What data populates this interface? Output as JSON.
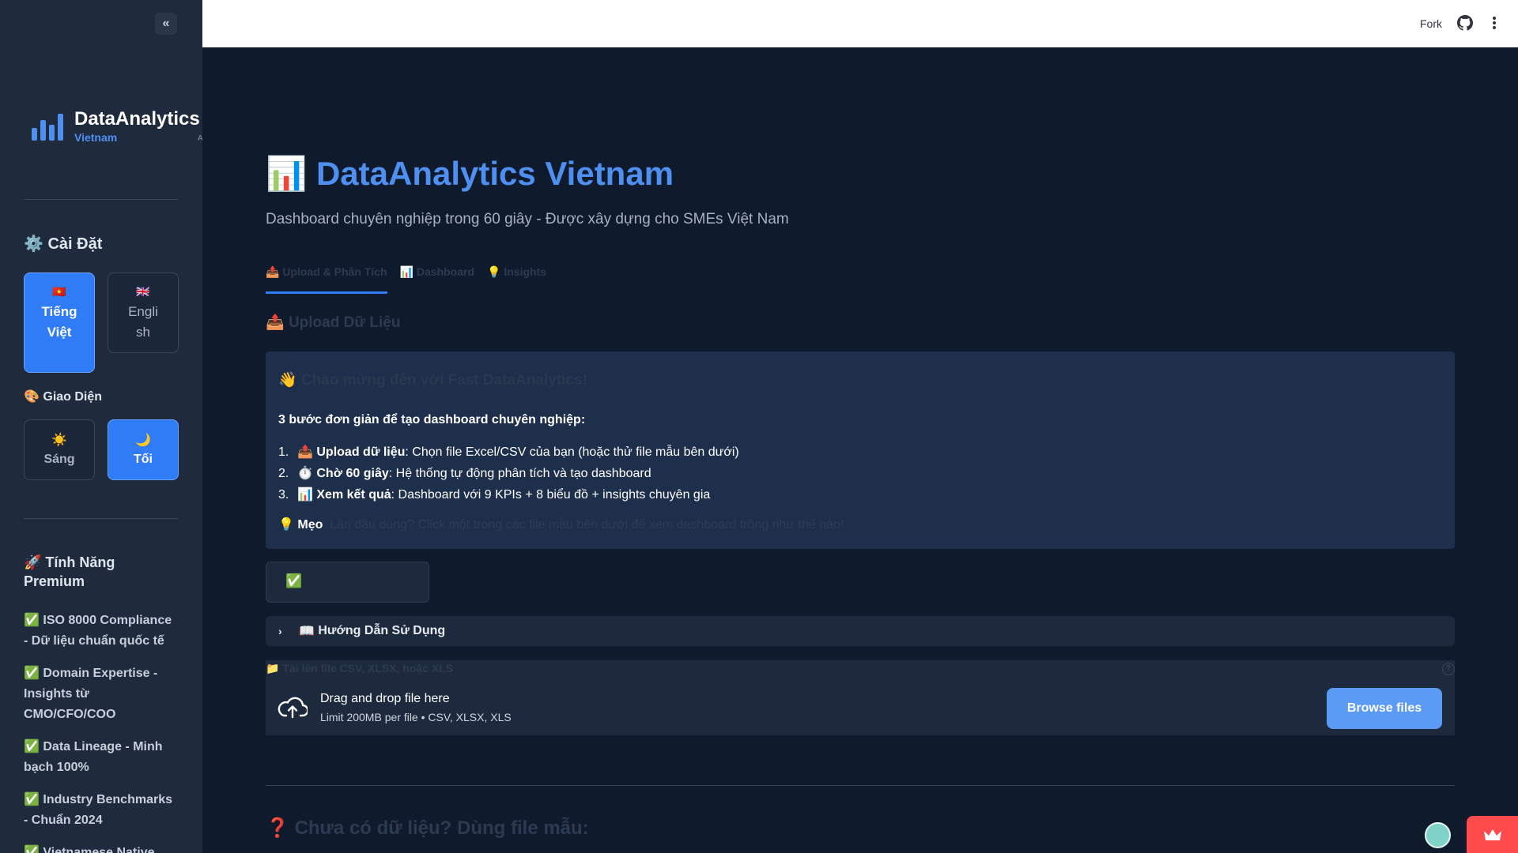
{
  "sidebar": {
    "brand_title": "DataAnalytics",
    "brand_subtitle": "Vietnam",
    "brand_overflow": "A",
    "settings_heading": "⚙️ Cài Đặt",
    "lang_vi": {
      "flag": "🇻🇳",
      "label": "Tiếng Việt"
    },
    "lang_en": {
      "flag": "🇬🇧",
      "label": "English"
    },
    "theme_heading": "🎨 Giao Diện",
    "theme_light": {
      "icon": "☀️",
      "label": "Sáng"
    },
    "theme_dark": {
      "icon": "🌙",
      "label": "Tối"
    },
    "premium_heading": "🚀 Tính Năng Premium",
    "features": [
      {
        "check": "✅",
        "bold": "ISO 8000 Compliance",
        "rest": " - Dữ liệu chuẩn quốc tế"
      },
      {
        "check": "✅",
        "bold": "Domain Expertise",
        "rest": " - Insights từ CMO/CFO/COO"
      },
      {
        "check": "✅",
        "bold": "Data Lineage",
        "rest": " - Minh bạch 100%"
      },
      {
        "check": "✅",
        "bold": "Industry Benchmarks",
        "rest": " - Chuẩn 2024"
      },
      {
        "check": "✅",
        "bold": "Vietnamese Native",
        "rest": ""
      }
    ]
  },
  "topbar": {
    "fork_label": "Fork"
  },
  "main": {
    "title_icon": "📊",
    "title": "DataAnalytics Vietnam",
    "subtitle": "Dashboard chuyên nghiệp trong 60 giây - Được xây dựng cho SMEs Việt Nam",
    "tabs": [
      {
        "icon": "📤",
        "label": "Upload & Phân Tích"
      },
      {
        "icon": "📊",
        "label": "Dashboard"
      },
      {
        "icon": "💡",
        "label": "Insights"
      }
    ],
    "section_icon": "📤",
    "section_heading": "Upload Dữ Liệu",
    "welcome": {
      "icon": "👋",
      "title": "Chào mừng đến với Fast DataAnalytics!",
      "steps_heading": "3 bước đơn giản để tạo dashboard chuyên nghiệp:",
      "steps": [
        {
          "num": "1.",
          "icon": "📤",
          "bold": "Upload dữ liệu",
          "rest": ": Chọn file Excel/CSV của bạn (hoặc thử file mẫu bên dưới)"
        },
        {
          "num": "2.",
          "icon": "⏱️",
          "bold": "Chờ 60 giây",
          "rest": ": Hệ thống tự động phân tích và tạo dashboard"
        },
        {
          "num": "3.",
          "icon": "📊",
          "bold": "Xem kết quả",
          "rest": ": Dashboard với 9 KPIs + 8 biểu đồ + insights chuyên gia"
        }
      ],
      "tip_icon": "💡",
      "tip_bold": "Mẹo",
      "tip_rest": ": Lần đầu dùng? Click một trong các file mẫu bên dưới để xem dashboard trông như thế nào!"
    },
    "status_icon": "✅",
    "expander_icon": "📖",
    "expander_label": "Hướng Dẫn Sử Dụng",
    "uploader": {
      "label_icon": "📁",
      "label": "Tải lên file CSV, XLSX, hoặc XLS",
      "help": "?",
      "drop_text": "Drag and drop file here",
      "limit_text": "Limit 200MB per file • CSV, XLSX, XLS",
      "browse_label": "Browse files"
    },
    "bottom_icon": "❓",
    "bottom_heading": "Chưa có dữ liệu? Dùng file mẫu:"
  },
  "colors": {
    "sidebar_bg": "#1f2b3d",
    "main_bg": "#0f1b2d",
    "accent": "#2f7cf6",
    "title_blue": "#4f8ff0",
    "badge_red": "#ff4b4b"
  }
}
